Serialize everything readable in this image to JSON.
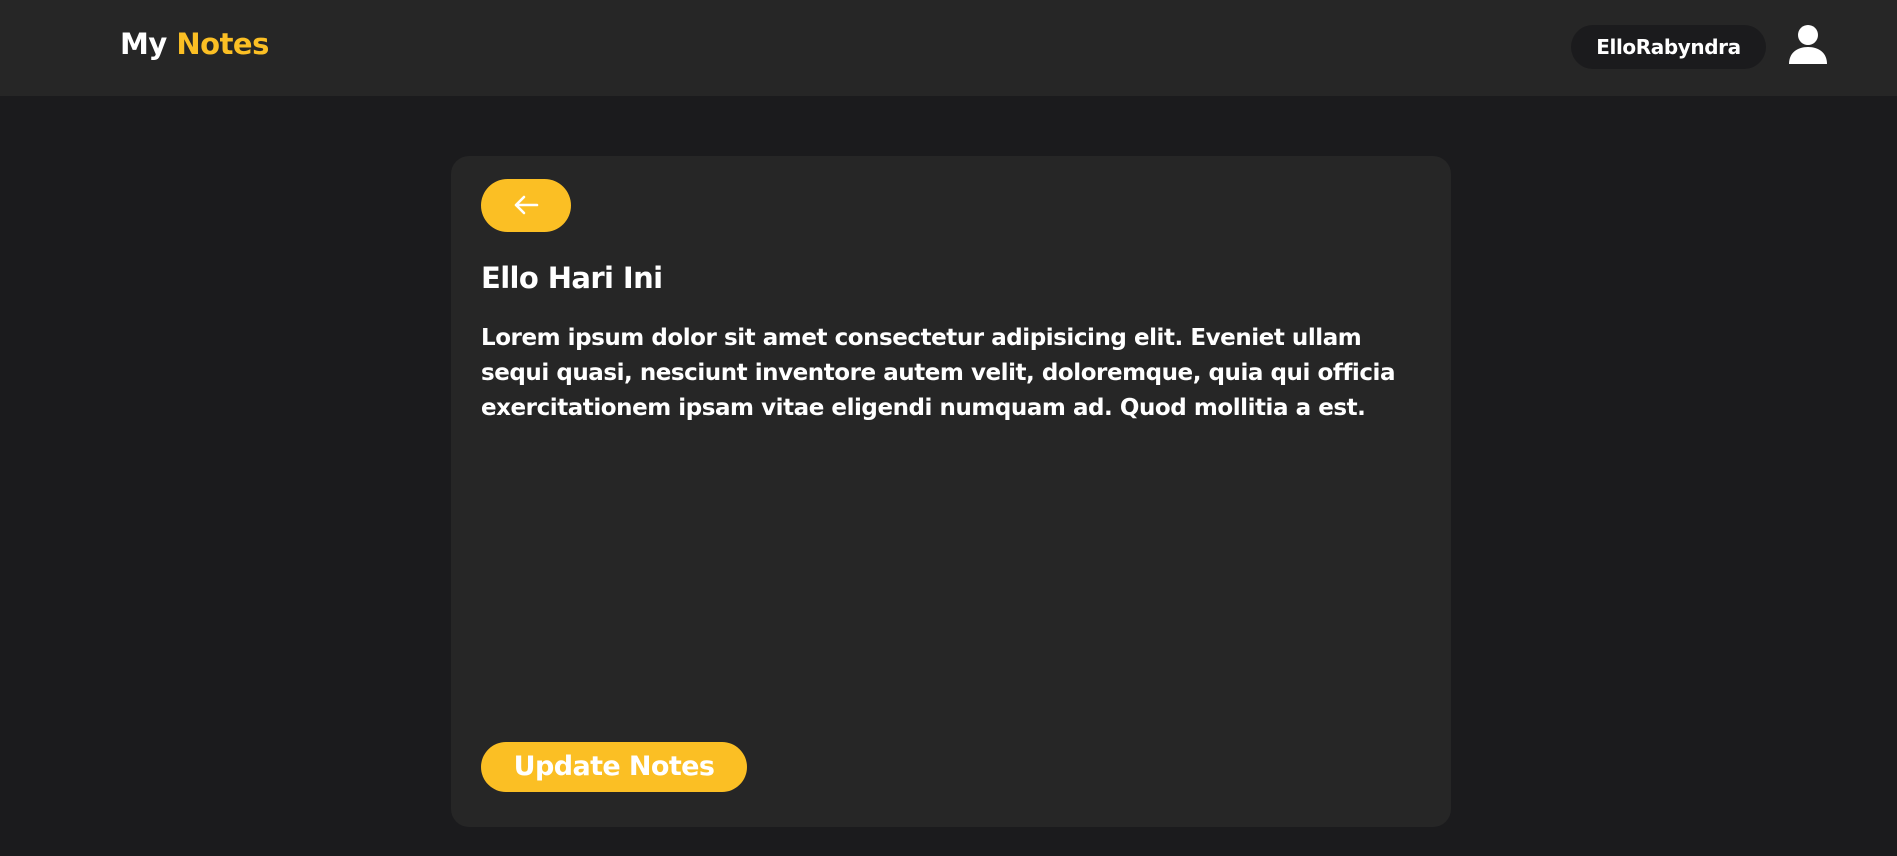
{
  "header": {
    "brand_prefix": "My",
    "brand_accent": "Notes",
    "username": "ElloRabyndra",
    "avatar_icon": "user-icon"
  },
  "note": {
    "back_icon": "arrow-left-icon",
    "title": "Ello Hari Ini",
    "body": "Lorem ipsum dolor sit amet consectetur adipisicing elit. Eveniet ullam sequi quasi, nesciunt inventore autem velit, doloremque, quia qui officia exercitationem ipsam vitae eligendi numquam ad. Quod mollitia a est.",
    "update_label": "Update Notes"
  },
  "colors": {
    "background": "#1b1b1d",
    "surface": "#262626",
    "accent": "#fbbf24",
    "text": "#ffffff"
  }
}
